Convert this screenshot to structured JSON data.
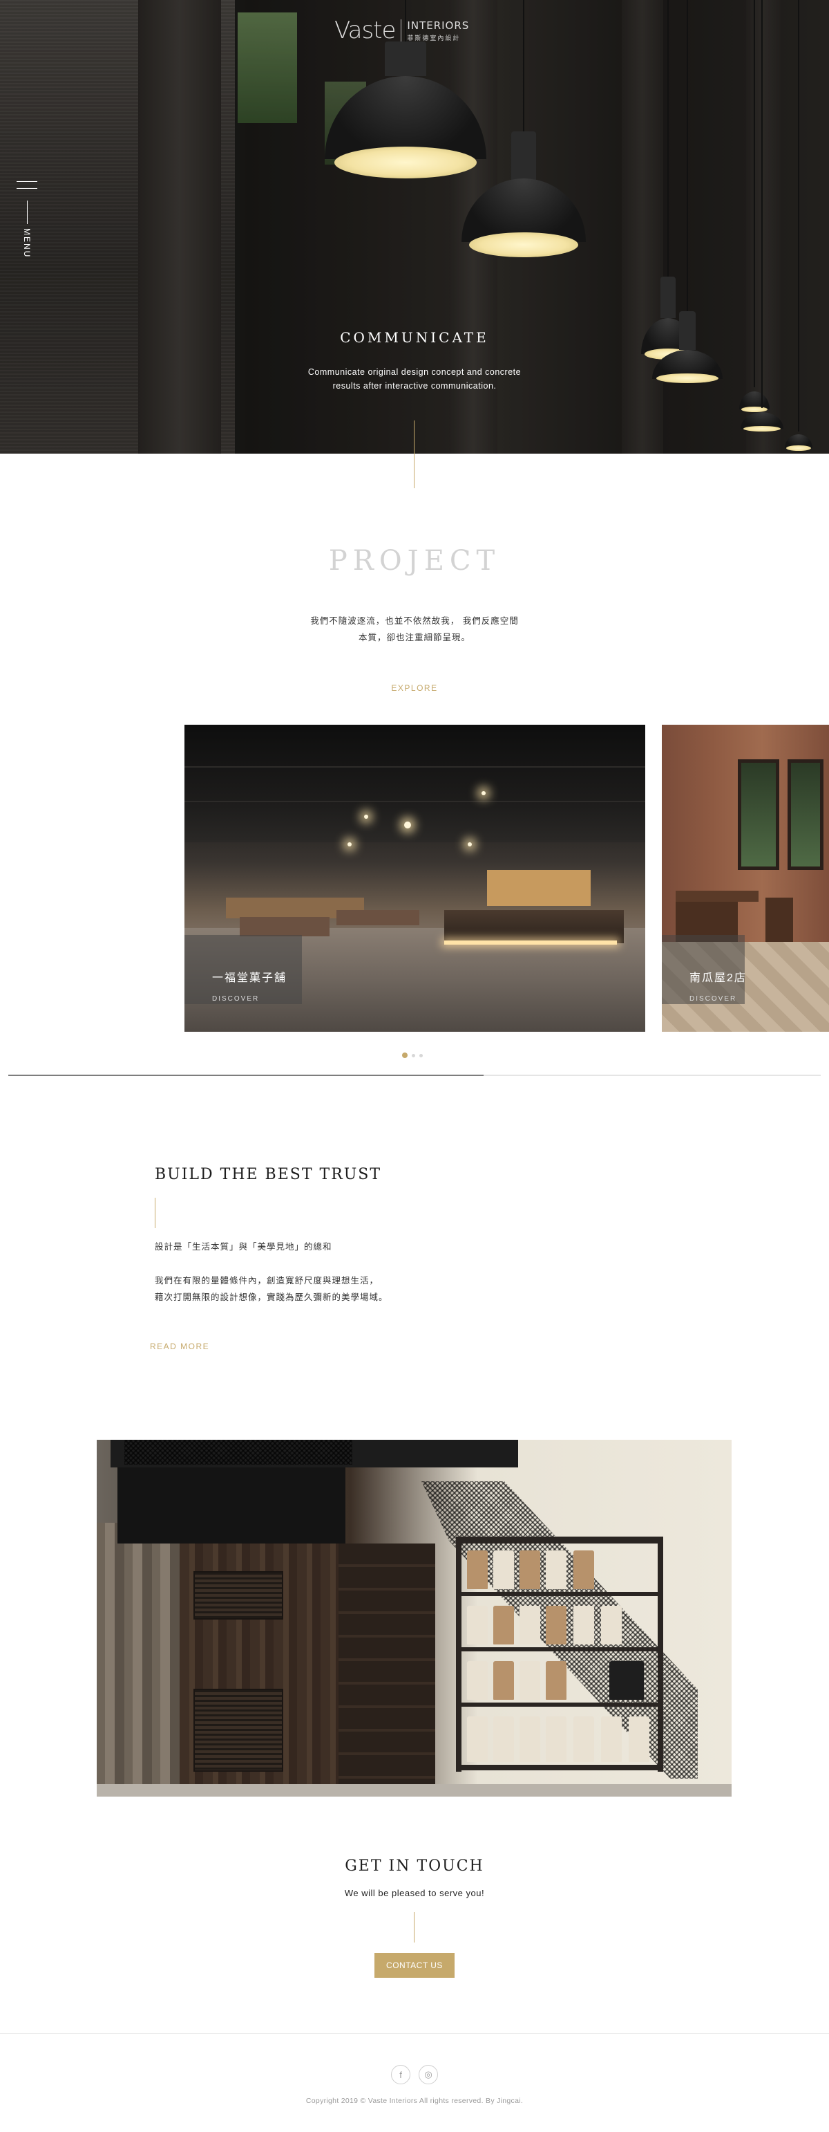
{
  "brand": {
    "logo_word": "Vaste",
    "logo_title": "INTERIORS",
    "logo_subtitle": "菲斯德室內設計"
  },
  "nav": {
    "menu_label": "MENU"
  },
  "hero": {
    "title": "COMMUNICATE",
    "line1": "Communicate original design concept and concrete",
    "line2": "results after interactive communication."
  },
  "project": {
    "title": "PROJECT",
    "desc_line1": "我們不隨波逐流，也並不依然故我， 我們反應空間",
    "desc_line2": "本質，卻也注重細節呈現。",
    "explore_label": "EXPLORE",
    "cards": [
      {
        "title": "一福堂菓子舖",
        "sub": "DISCOVER"
      },
      {
        "title": "南瓜屋2店",
        "sub": "DISCOVER"
      }
    ],
    "slider_progress": 0.585
  },
  "trust": {
    "title": "BUILD THE BEST TRUST",
    "p1": "設計是「生活本質」與「美學見地」的總和",
    "p2_line1": "我們在有限的量體條件內，創造寬舒尺度與理想生活，",
    "p2_line2": "藉次打開無限的設計想像，實踐為歷久彌新的美學場域。",
    "read_more_label": "READ MORE"
  },
  "contact": {
    "title": "GET IN TOUCH",
    "subtitle": "We will be pleased to serve you!",
    "button_label": "CONTACT US"
  },
  "footer": {
    "facebook_glyph": "f",
    "instagram_glyph": "◎",
    "copyright": "Copyright 2019 © Vaste Interiors All rights reserved. By Jingcai."
  },
  "colors": {
    "accent": "#c6a96b",
    "text": "#333333",
    "muted_title": "#d3d3d3"
  }
}
